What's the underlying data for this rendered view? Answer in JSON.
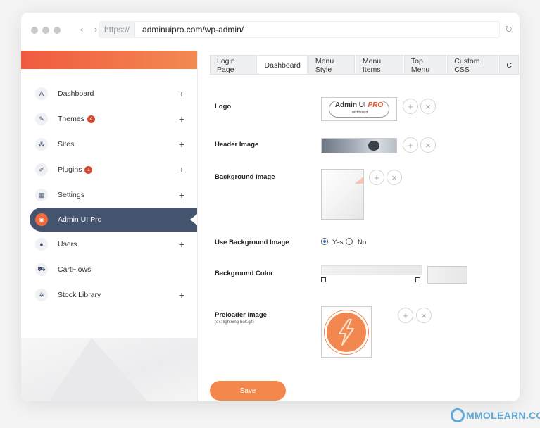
{
  "browser": {
    "url_proto": "https://",
    "url": "adminuipro.com/wp-admin/",
    "nav_arrows": "‹ ›",
    "reload_icon": "↻"
  },
  "sidebar": {
    "items": [
      {
        "label": "Dashboard",
        "icon": "A",
        "badge": "",
        "plus": "+"
      },
      {
        "label": "Themes",
        "icon": "✎",
        "badge": "4",
        "plus": "+"
      },
      {
        "label": "Sites",
        "icon": "⁂",
        "badge": "",
        "plus": "+"
      },
      {
        "label": "Plugins",
        "icon": "✐",
        "badge": "1",
        "plus": "+"
      },
      {
        "label": "Settings",
        "icon": "▦",
        "badge": "",
        "plus": "+"
      },
      {
        "label": "Admin UI Pro",
        "icon": "◉",
        "badge": "",
        "plus": ""
      },
      {
        "label": "Users",
        "icon": "●",
        "badge": "",
        "plus": "+"
      },
      {
        "label": "CartFlows",
        "icon": "⛟",
        "badge": "",
        "plus": ""
      },
      {
        "label": "Stock Library",
        "icon": "✲",
        "badge": "",
        "plus": "+"
      }
    ]
  },
  "tabs": [
    "Login Page",
    "Dashboard",
    "Menu Style",
    "Menu Items",
    "Top Menu",
    "Custom CSS",
    "C"
  ],
  "form": {
    "logo_label": "Logo",
    "logo_text_a": "Admin UI ",
    "logo_text_b": "PRO",
    "logo_sub": "Dashboard",
    "header_label": "Header Image",
    "bg_image_label": "Background Image",
    "use_bg_label": "Use Background Image",
    "yes_label": "Yes",
    "no_label": "No",
    "bg_color_label": "Background Color",
    "preloader_label": "Preloader Image",
    "preloader_hint": "(ex: lightning-bolt.gif)",
    "plus_glyph": "+",
    "x_glyph": "×",
    "save_label": "Save"
  },
  "watermark": "MMOLEARN.COM",
  "colors": {
    "accent": "#f4874c",
    "active_menu": "#44546e",
    "brand_gradient_start": "#ef5a3f",
    "badge": "#d6452e"
  }
}
